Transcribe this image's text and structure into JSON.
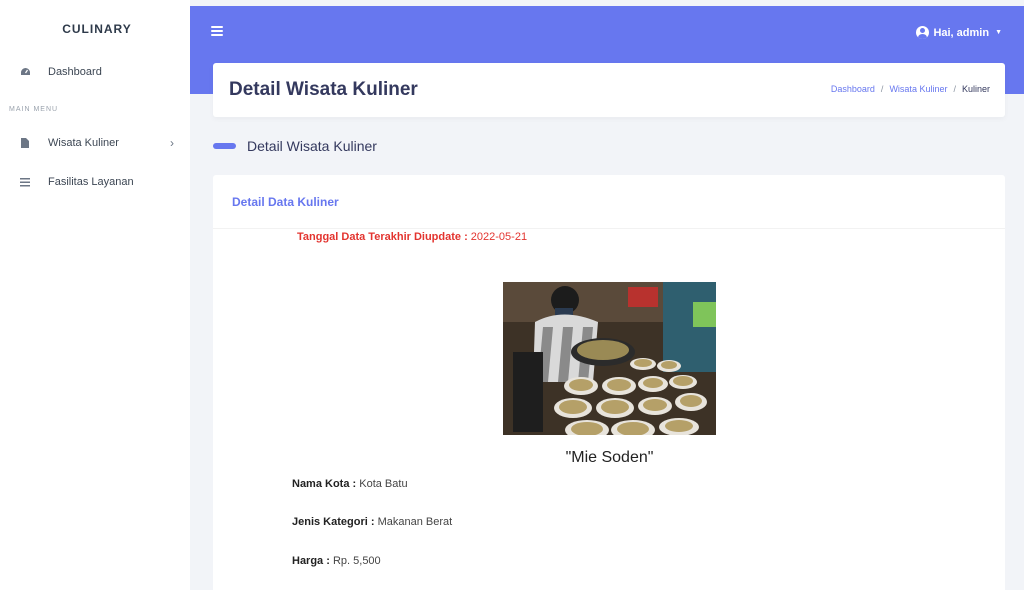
{
  "sidebar": {
    "brand": "CULINARY",
    "dashboard": "Dashboard",
    "menu_header": "MAIN MENU",
    "items": [
      {
        "label": "Wisata Kuliner",
        "icon": "file-icon"
      },
      {
        "label": "Fasilitas Layanan",
        "icon": "list-icon"
      }
    ]
  },
  "topbar": {
    "user_label": "Hai, admin"
  },
  "header": {
    "title": "Detail Wisata Kuliner",
    "breadcrumb": [
      "Dashboard",
      "Wisata Kuliner",
      "Kuliner"
    ]
  },
  "section": {
    "title": "Detail Wisata Kuliner"
  },
  "card": {
    "title": "Detail Data Kuliner",
    "updated_label": "Tanggal Data Terakhir Diupdate :",
    "updated_value": "2022-05-21",
    "food_name": "\"Mie Soden\"",
    "fields": [
      {
        "label": "Nama Kota :",
        "value": "Kota Batu"
      },
      {
        "label": "Jenis Kategori :",
        "value": "Makanan Berat"
      },
      {
        "label": "Harga :",
        "value": "Rp. 5,500"
      }
    ]
  },
  "colors": {
    "primary": "#6777ef",
    "danger": "#e3342f",
    "background": "#f2f4f8"
  }
}
